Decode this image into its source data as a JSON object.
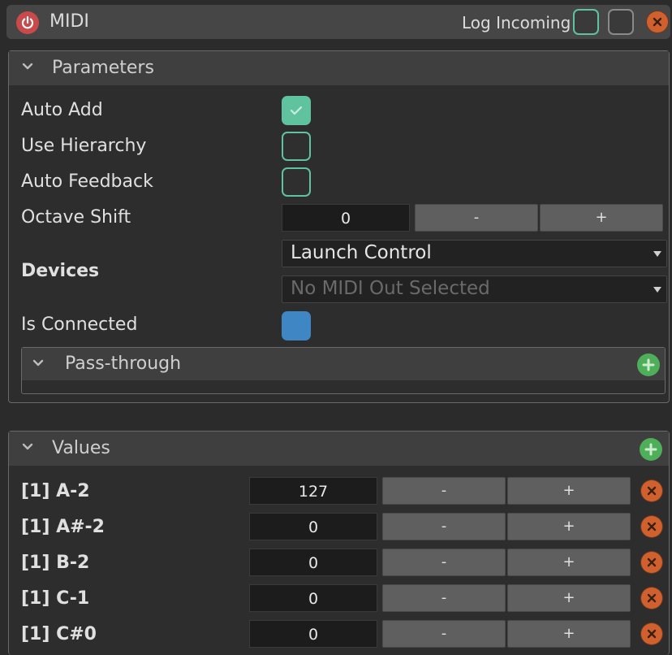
{
  "titlebar": {
    "title": "MIDI",
    "log_incoming_label": "Log Incoming"
  },
  "parameters": {
    "header": "Parameters",
    "auto_add": {
      "label": "Auto Add",
      "checked": true
    },
    "use_hierarchy": {
      "label": "Use Hierarchy",
      "checked": false
    },
    "auto_feedback": {
      "label": "Auto Feedback",
      "checked": false
    },
    "octave_shift": {
      "label": "Octave Shift",
      "value": "0",
      "minus": "-",
      "plus": "+"
    },
    "devices": {
      "label": "Devices",
      "input_device": "Launch Control",
      "output_device": "No MIDI Out Selected"
    },
    "is_connected": {
      "label": "Is Connected"
    },
    "pass_through": {
      "header": "Pass-through"
    }
  },
  "values": {
    "header": "Values",
    "rows": [
      {
        "label": "[1] A-2",
        "value": "127",
        "minus": "-",
        "plus": "+"
      },
      {
        "label": "[1] A#-2",
        "value": "0",
        "minus": "-",
        "plus": "+"
      },
      {
        "label": "[1] B-2",
        "value": "0",
        "minus": "-",
        "plus": "+"
      },
      {
        "label": "[1] C-1",
        "value": "0",
        "minus": "-",
        "plus": "+"
      },
      {
        "label": "[1] C#0",
        "value": "0",
        "minus": "-",
        "plus": "+"
      }
    ]
  },
  "colors": {
    "accent": "#5fc3a0",
    "connected": "#3f86c4",
    "remove": "#d0602e",
    "add": "#4fae5a",
    "power": "#c94a4a"
  }
}
